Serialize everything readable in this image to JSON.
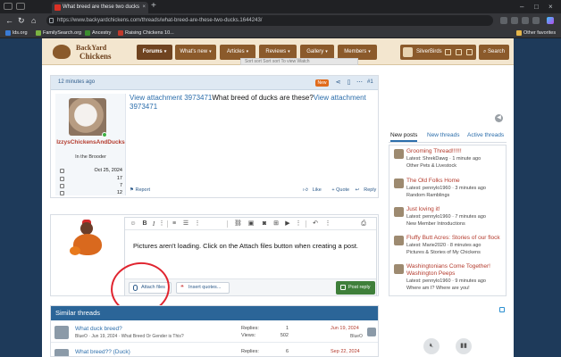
{
  "browser": {
    "tab_title": "What breed are these two ducks",
    "url": "https://www.backyardchickens.com/threads/what-breed-are-these-two-ducks.1644243/",
    "bookmarks": [
      {
        "label": "lds.org",
        "color": "#3a7bd5"
      },
      {
        "label": "FamilySearch.org",
        "color": "#7bb342"
      },
      {
        "label": "Ancestry",
        "color": "#3c8d2f"
      },
      {
        "label": "Raising Chickens 10...",
        "color": "#c0392b"
      },
      {
        "label": "Other favorites",
        "color": "#e5b54a"
      }
    ]
  },
  "site": {
    "logo_line1": "BackYard",
    "logo_line2": "Chickens",
    "nav": [
      {
        "label": "Forums",
        "active": true
      },
      {
        "label": "What's new"
      },
      {
        "label": "Articles"
      },
      {
        "label": "Reviews"
      },
      {
        "label": "Gallery"
      },
      {
        "label": "Members"
      }
    ],
    "username": "SilverBirds",
    "search_label": "Search",
    "stub_text": "Sort sort   Sort sort   To view   Watch"
  },
  "post": {
    "time": "12 minutes ago",
    "badge": "New",
    "number": "#1",
    "author": "IzzysChickensAndDucks",
    "author_title": "In the Brooder",
    "stats": [
      {
        "icon": "calendar-icon",
        "value": "Oct 25, 2024"
      },
      {
        "icon": "message-icon",
        "value": "17"
      },
      {
        "icon": "thumbs-up-icon",
        "value": "7"
      },
      {
        "icon": "trophy-icon",
        "value": "12"
      }
    ],
    "body_link1": "View attachment 3973471",
    "body_question": "What breed of ducks are these?",
    "body_link2": "View attachment 3973471",
    "report": "Report",
    "like": "Like",
    "quote": "+ Quote",
    "reply": "Reply"
  },
  "reply_box": {
    "text": "Pictures aren't loading. Click on the Attach files button when creating a post.",
    "attach_label": "Attach files",
    "quotes_label": "Insert quotes...",
    "post_reply_label": "Post reply"
  },
  "similar": {
    "heading": "Similar threads",
    "threads": [
      {
        "title": "What duck breed?",
        "meta": "BlueO · Jun 19, 2024 · What Breed Or Gender is This?",
        "replies_label": "Replies:",
        "replies": "1",
        "views_label": "Views:",
        "views": "502",
        "date": "Jun 19, 2024",
        "last": "BlueO"
      },
      {
        "title": "What breed?? (Duck)",
        "meta": "",
        "replies_label": "Replies:",
        "replies": "6",
        "views_label": "Views:",
        "views": "",
        "date": "Sep 22, 2024",
        "last": ""
      }
    ]
  },
  "sidebar": {
    "tabs": [
      "New posts",
      "New threads",
      "Active threads"
    ],
    "items": [
      {
        "title": "Grooming Thread!!!!!!",
        "latest": "Latest: ShrekDawg · 1 minute ago",
        "forum": "Other Pets & Livestock"
      },
      {
        "title": "The Old Folks Home",
        "latest": "Latest: pennylo1960 · 3 minutes ago",
        "forum": "Random Ramblings"
      },
      {
        "title": "Just loving it!",
        "latest": "Latest: pennylo1960 · 7 minutes ago",
        "forum": "New Member Introductions"
      },
      {
        "title": "Fluffy Butt Acres: Stories of our flock",
        "latest": "Latest: Marie2020 · 8 minutes ago",
        "forum": "Pictures & Stories of My Chickens"
      },
      {
        "title": "Washingtonians Come Together! Washington Peeps",
        "latest": "Latest: pennylo1960 · 9 minutes ago",
        "forum": "Where am I? Where are you!"
      }
    ]
  }
}
